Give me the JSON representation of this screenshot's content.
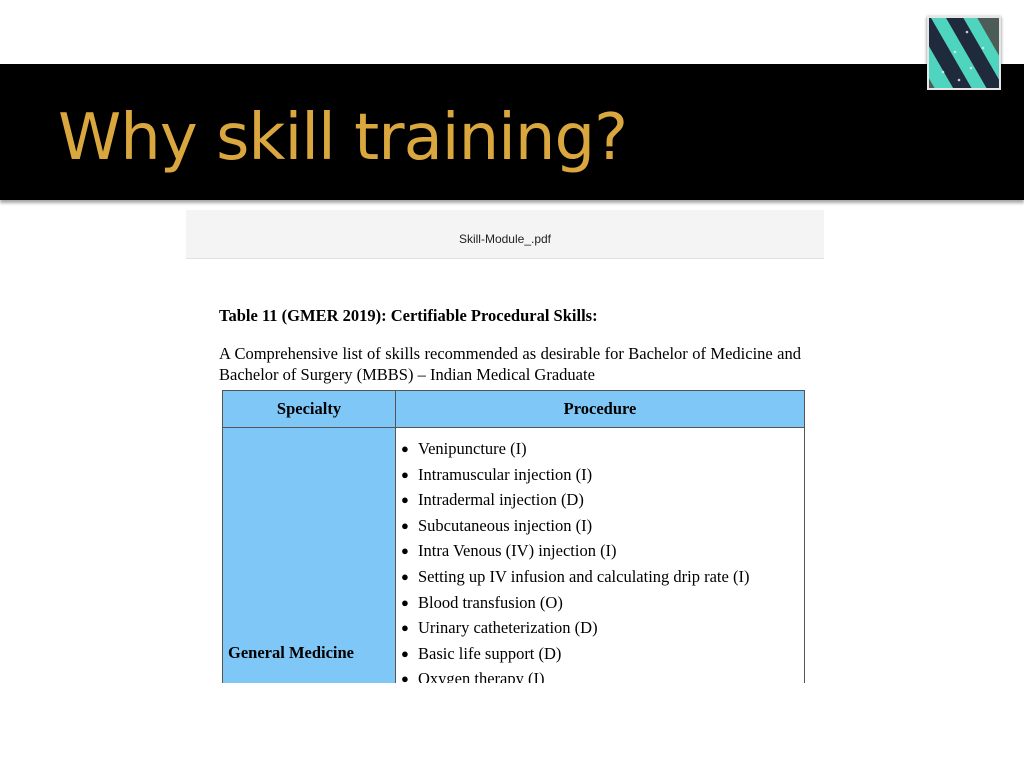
{
  "slide": {
    "title": "Why skill training?",
    "logo_icon": "striped-tie-logo-icon",
    "colors": {
      "title_bar": "#000000",
      "title_text": "#d9a73d",
      "table_header": "#7fc7f7"
    }
  },
  "pdf": {
    "filename": "Skill-Module_.pdf",
    "heading": "Table 11 (GMER 2019): Certifiable Procedural Skills:",
    "intro": "A Comprehensive list of skills recommended as desirable for Bachelor of Medicine and Bachelor of Surgery (MBBS) – Indian Medical Graduate",
    "table": {
      "headers": [
        "Specialty",
        "Procedure"
      ],
      "rows": [
        {
          "specialty": "General Medicine",
          "procedures": [
            "Venipuncture (I)",
            "Intramuscular injection (I)",
            "Intradermal injection (D)",
            "Subcutaneous injection (I)",
            "Intra Venous (IV) injection (I)",
            "Setting up IV infusion and calculating drip rate (I)",
            "Blood transfusion (O)",
            "Urinary catheterization (D)",
            "Basic life support (D)",
            "Oxygen therapy (I)"
          ]
        }
      ]
    }
  }
}
